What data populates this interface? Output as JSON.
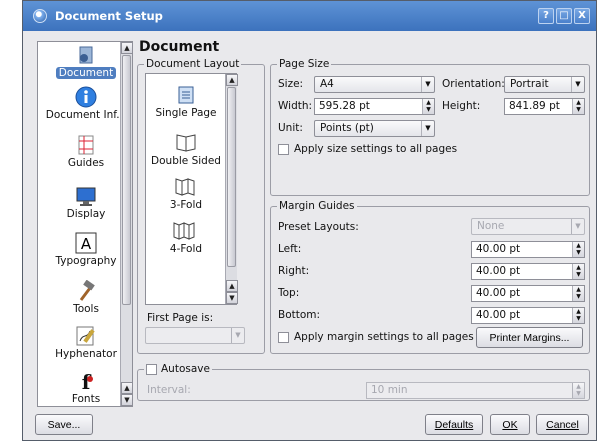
{
  "window": {
    "title": "Document Setup",
    "buttons": [
      "?",
      "□",
      "X"
    ]
  },
  "sidebar": {
    "items": [
      {
        "label": "Document",
        "icon": "document-icon",
        "selected": true
      },
      {
        "label": "Document Inf...",
        "icon": "info-icon",
        "selected": false
      },
      {
        "label": "Guides",
        "icon": "guides-icon",
        "selected": false
      },
      {
        "label": "Display",
        "icon": "display-icon",
        "selected": false
      },
      {
        "label": "Typography",
        "icon": "typography-icon",
        "selected": false
      },
      {
        "label": "Tools",
        "icon": "hammer-icon",
        "selected": false
      },
      {
        "label": "Hyphenator",
        "icon": "hyphenator-icon",
        "selected": false
      },
      {
        "label": "Fonts",
        "icon": "fonts-icon",
        "selected": false
      }
    ]
  },
  "main": {
    "heading": "Document",
    "layout": {
      "title": "Document Layout",
      "items": [
        {
          "label": "Single Page",
          "selected": true
        },
        {
          "label": "Double Sided",
          "selected": false
        },
        {
          "label": "3-Fold",
          "selected": false
        },
        {
          "label": "4-Fold",
          "selected": false
        }
      ],
      "first_page_label": "First Page is:",
      "first_page_value": ""
    },
    "page_size": {
      "title": "Page Size",
      "size_label": "Size:",
      "size_value": "A4",
      "orientation_label": "Orientation:",
      "orientation_value": "Portrait",
      "width_label": "Width:",
      "width_value": "595.28 pt",
      "height_label": "Height:",
      "height_value": "841.89 pt",
      "unit_label": "Unit:",
      "unit_value": "Points (pt)",
      "apply_label": "Apply size settings to all pages"
    },
    "margins": {
      "title": "Margin Guides",
      "preset_label": "Preset Layouts:",
      "preset_value": "None",
      "left_label": "Left:",
      "left_value": "40.00 pt",
      "right_label": "Right:",
      "right_value": "40.00 pt",
      "top_label": "Top:",
      "top_value": "40.00 pt",
      "bottom_label": "Bottom:",
      "bottom_value": "40.00 pt",
      "apply_label": "Apply margin settings to all pages",
      "printer_margins_label": "Printer Margins..."
    },
    "autosave": {
      "label": "Autosave",
      "interval_label": "Interval:",
      "interval_value": "10 min"
    }
  },
  "footer": {
    "save_label": "Save...",
    "defaults_label": "Defaults",
    "ok_label": "OK",
    "cancel_label": "Cancel"
  }
}
